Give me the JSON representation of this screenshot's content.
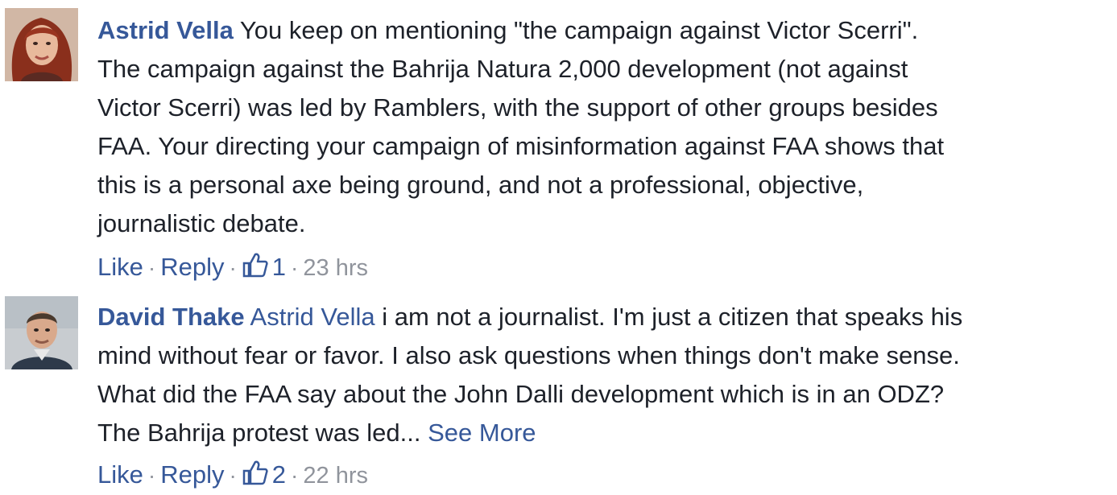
{
  "comments": [
    {
      "author": "Astrid Vella",
      "avatar_icon": "woman-avatar",
      "lines": [
        "You keep on mentioning \"the campaign against Victor Scerri\".",
        "The campaign against the Bahrija Natura 2,000 development (not against",
        "Victor Scerri) was led by Ramblers, with the support of other groups besides",
        "FAA. Your directing your campaign of misinformation against FAA shows that",
        "this is a personal axe being ground, and not a professional, objective,",
        "journalistic debate."
      ],
      "actions": {
        "like": "Like",
        "reply": "Reply",
        "like_count": "1",
        "time": "23 hrs"
      }
    },
    {
      "author": "David Thake",
      "avatar_icon": "man-avatar",
      "mention": "Astrid Vella",
      "lines": [
        "i am not a journalist. I'm just a citizen that speaks his",
        "mind without fear or favor. I also ask questions when things don't make sense.",
        "What did the FAA say about the John Dalli development which is in an ODZ?",
        "The Bahrija protest was led..."
      ],
      "see_more": "See More",
      "actions": {
        "like": "Like",
        "reply": "Reply",
        "like_count": "2",
        "time": "22 hrs"
      }
    }
  ],
  "colors": {
    "link": "#365899",
    "text": "#1d2129",
    "meta": "#90949c"
  }
}
